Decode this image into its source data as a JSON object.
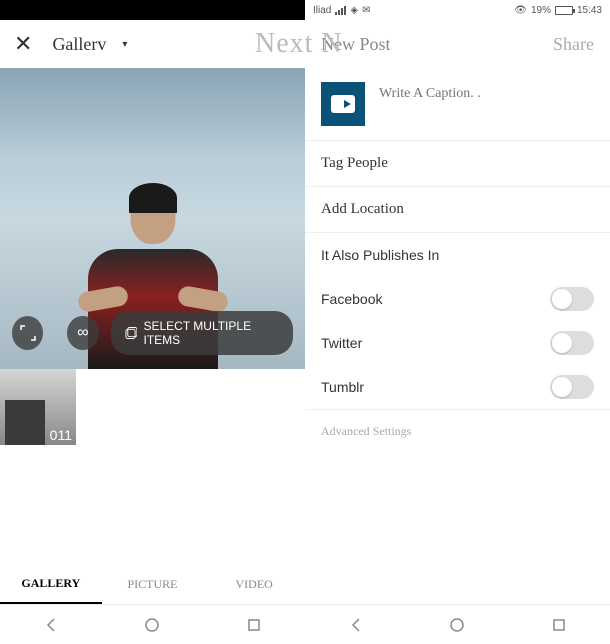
{
  "left": {
    "header": {
      "gallery_label": "Gallerv",
      "next_label": "Next N"
    },
    "controls": {
      "select_multiple_label": "SELECT MULTIPLE ITEMS"
    },
    "thumbnail": {
      "duration": "011"
    },
    "tabs": {
      "gallery": "GALLERY",
      "picture": "PICTURE",
      "video": "VIDEO"
    }
  },
  "right": {
    "status": {
      "carrier": "Iliad",
      "battery_pct": "19%",
      "time": "15:43"
    },
    "header": {
      "title": "New Post",
      "share": "Share"
    },
    "caption_placeholder": "Write A Caption. .",
    "tag_people": "Tag People",
    "add_location": "Add Location",
    "also_publishes": "It Also Publishes In",
    "toggles": {
      "facebook": "Facebook",
      "twitter": "Twitter",
      "tumblr": "Tumblr"
    },
    "advanced": "Advanced Settings"
  }
}
